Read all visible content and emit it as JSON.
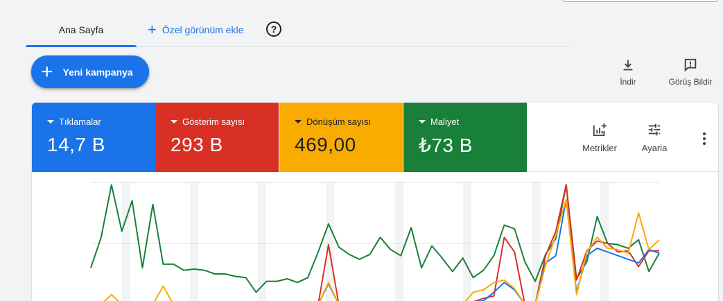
{
  "tabs": {
    "home": "Ana Sayfa",
    "add_view": "Özel görünüm ekle"
  },
  "actions": {
    "new_campaign": "Yeni kampanya",
    "download": "İndir",
    "feedback": "Görüş Bildir"
  },
  "metrics": [
    {
      "label": "Tıklamalar",
      "value": "14,7 B",
      "color": "#1a73e8"
    },
    {
      "label": "Gösterim sayısı",
      "value": "293 B",
      "color": "#d93025"
    },
    {
      "label": "Dönüşüm sayısı",
      "value": "469,00",
      "color": "#f9ab00"
    },
    {
      "label": "Maliyet",
      "value": "₺73 B",
      "color": "#188038"
    }
  ],
  "card_tools": {
    "metrics": "Metrikler",
    "adjust": "Ayarla"
  },
  "chart_data": {
    "type": "line",
    "ylim": [
      0,
      100
    ],
    "grid": true,
    "series": [
      {
        "color": "#188038",
        "values": [
          30,
          55,
          98,
          60,
          85,
          30,
          82,
          33,
          33,
          28,
          29,
          28,
          25,
          25,
          23,
          22,
          10,
          19,
          19,
          21,
          18,
          22,
          43,
          66,
          47,
          41,
          37,
          41,
          55,
          45,
          40,
          63,
          30,
          48,
          38,
          27,
          38,
          22,
          28,
          40,
          65,
          62,
          35,
          19,
          41,
          54,
          98,
          21,
          35,
          72,
          50,
          49,
          46,
          53,
          27,
          42
        ]
      },
      {
        "color": "#d93025",
        "values": [
          0,
          0,
          0,
          0,
          0,
          0,
          0,
          0,
          0,
          0,
          0,
          0,
          0,
          0,
          0,
          0,
          0,
          0,
          0,
          0,
          0,
          0,
          0,
          49,
          0,
          0,
          0,
          0,
          0,
          0,
          0,
          0,
          0,
          0,
          0,
          0,
          0,
          2,
          5,
          7,
          55,
          43,
          0,
          0,
          40,
          60,
          98,
          20,
          44,
          52,
          50,
          43,
          44,
          31,
          44,
          44
        ]
      },
      {
        "color": "#1a73e8",
        "values": [
          0,
          0,
          0,
          0,
          0,
          0,
          0,
          0,
          0,
          0,
          0,
          0,
          0,
          0,
          0,
          0,
          0,
          0,
          0,
          0,
          0,
          0,
          0,
          17,
          0,
          0,
          0,
          0,
          0,
          0,
          0,
          0,
          0,
          0,
          0,
          0,
          0,
          2,
          3,
          10,
          18,
          12,
          0,
          0,
          34,
          40,
          86,
          10,
          40,
          46,
          43,
          40,
          37,
          34,
          45,
          42
        ]
      },
      {
        "color": "#f9ab00",
        "values": [
          0,
          0,
          8,
          0,
          0,
          0,
          0,
          15,
          0,
          0,
          0,
          0,
          0,
          0,
          0,
          0,
          0,
          0,
          0,
          0,
          0,
          0,
          0,
          18,
          0,
          0,
          0,
          0,
          0,
          0,
          0,
          0,
          0,
          0,
          0,
          0,
          0,
          10,
          12,
          18,
          20,
          13,
          0,
          0,
          32,
          57,
          86,
          8,
          43,
          55,
          46,
          45,
          42,
          75,
          45,
          53
        ]
      }
    ]
  }
}
